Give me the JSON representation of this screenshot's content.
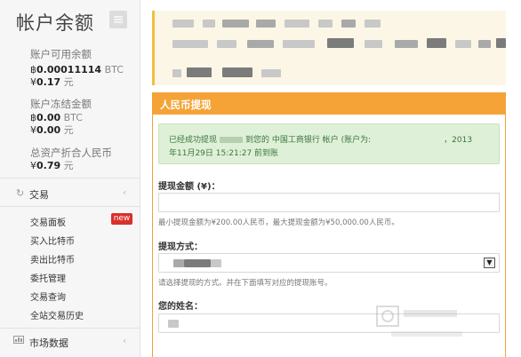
{
  "sidebar": {
    "title": "帐户余额",
    "balances": [
      {
        "label": "账户可用余额",
        "crypto_prefix": "฿",
        "crypto_value": "0.00011114",
        "crypto_unit": " BTC",
        "cny_prefix": "¥",
        "cny_value": "0.17",
        "cny_unit": " 元"
      },
      {
        "label": "账户冻结金额",
        "crypto_prefix": "฿",
        "crypto_value": "0.00",
        "crypto_unit": " BTC",
        "cny_prefix": "¥",
        "cny_value": "0.00",
        "cny_unit": " 元"
      },
      {
        "label": "总资产折合人民币",
        "cny_prefix": "¥",
        "cny_value": "0.79",
        "cny_unit": " 元"
      }
    ],
    "trade_section": {
      "icon": "refresh-icon",
      "label": "交易"
    },
    "trade_items": [
      "交易面板",
      "买入比特币",
      "卖出比特币",
      "委托管理",
      "交易查询",
      "全站交易历史"
    ],
    "new_badge": "new",
    "market_section": {
      "icon": "chart-icon",
      "label": "市场数据"
    }
  },
  "panel": {
    "title": "人民币提现",
    "success_line1_a": "已经成功提现",
    "success_line1_b": "到您的 中国工商银行 帐户 (账户为:",
    "success_line1_c": "，2013",
    "success_line2": "年11月29日 15:21:27 前到账",
    "amount_label": "提现金额 (¥)：",
    "amount_help": "最小提现金额为¥200.00人民币，最大提现金额为¥50,000.00人民币。",
    "method_label": "提现方式：",
    "method_help": "请选择提现的方式。并在下面填写对应的提现账号。",
    "name_label": "您的姓名："
  },
  "colors": {
    "accent": "#f5a336",
    "success_bg": "#dff0d8",
    "success_text": "#3c763d",
    "badge": "#d9302c",
    "notice_border": "#f0c040"
  }
}
